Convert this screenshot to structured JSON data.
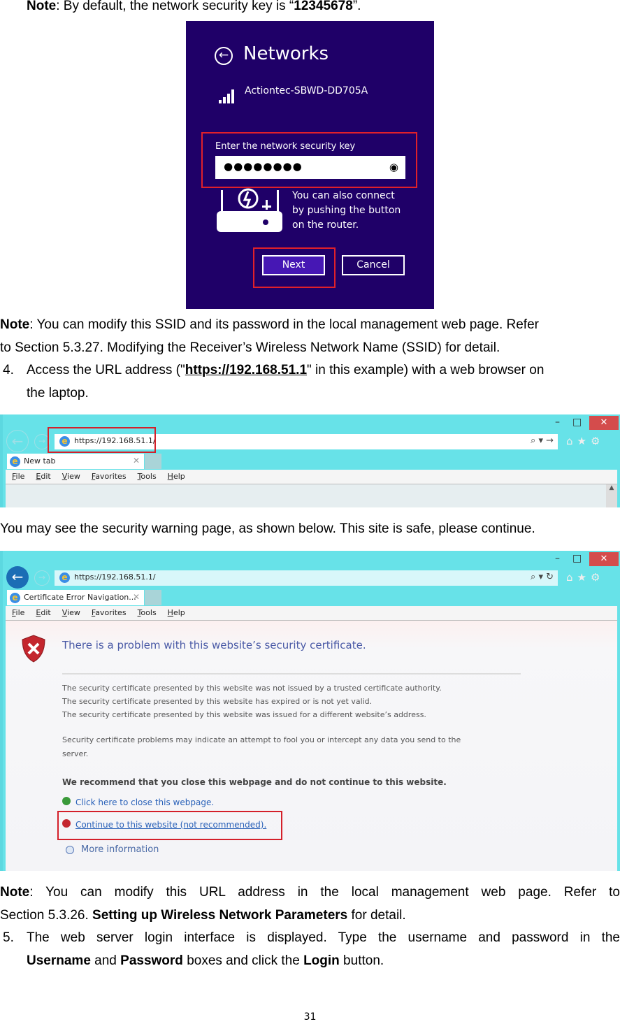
{
  "doc": {
    "note1": {
      "label": "Note",
      "text_before": ": By default, the network security key is “",
      "key": "12345678",
      "text_after": "”."
    },
    "note2": {
      "label": "Note",
      "line1_rest": ": You can modify this SSID and its password in the local management web page. Refer",
      "line2": "to Section 5.3.27. Modifying the Receiver’s Wireless Network Name (SSID) for detail."
    },
    "step4": {
      "number": "4.",
      "before": "Access the URL address (\"",
      "url": "https://192.168.51.1",
      "after": "\" in this example) with a web browser on",
      "line2": "the laptop."
    },
    "warning_text": "You may see the security warning page, as shown below. This site is safe, please continue.",
    "note3": {
      "label": "Note",
      "line1_rest": ":  You  can  modify  this  URL  address  in  the  local  management  web  page.  Refer  to",
      "line2_before": "Section 5.3.26. ",
      "line2_bold": "Setting up Wireless Network Parameters",
      "line2_after": " for detail."
    },
    "step5": {
      "number": "5.",
      "line1": "The web server login interface is displayed. Type the username and password in the",
      "b1": "Username",
      "t1": " and ",
      "b2": "Password",
      "t2": " boxes and click the ",
      "b3": "Login",
      "t3": " button."
    },
    "page_number": "31"
  },
  "networks_panel": {
    "back_icon": "←",
    "title": "Networks",
    "ssid": "Actiontec-SBWD-DD705A",
    "key_label": "Enter the network security key",
    "key_value": "●●●●●●●●",
    "wps_lines": [
      "You can also connect",
      "by pushing the button",
      "on the router."
    ],
    "next_label": "Next",
    "cancel_label": "Cancel",
    "colors": {
      "background": "#1f0068",
      "next": "#4617b4",
      "highlight": "#e0202a"
    }
  },
  "browser1": {
    "url": "https://192.168.51.1/",
    "tab_label": "New tab",
    "menu": [
      "File",
      "Edit",
      "View",
      "Favorites",
      "Tools",
      "Help"
    ],
    "addr_tools": "⌕ ▾ →",
    "window_buttons": {
      "minimize": "–",
      "maximize": "□",
      "close": "✕"
    },
    "toolbar_icons": "⌂★⚙"
  },
  "browser2": {
    "url": "https://192.168.51.1/",
    "tab_label": "Certificate Error Navigation...",
    "menu": [
      "File",
      "Edit",
      "View",
      "Favorites",
      "Tools",
      "Help"
    ],
    "addr_tools": "⌕ ▾ ↻",
    "window_buttons": {
      "minimize": "–",
      "maximize": "□",
      "close": "✕"
    },
    "toolbar_icons": "⌂★⚙",
    "cert": {
      "heading": "There is a problem with this website’s security certificate.",
      "reasons": [
        "The security certificate presented by this website was not issued by a trusted certificate authority.",
        "The security certificate presented by this website has expired or is not yet valid.",
        "The security certificate presented by this website was issued for a different website’s address."
      ],
      "explain1": "Security certificate problems may indicate an attempt to fool you or intercept any data you send to the",
      "explain2": "server.",
      "recommend": "We recommend that you close this webpage and do not continue to this website.",
      "close_link": "Click here to close this webpage.",
      "continue_link": "Continue to this website (not recommended).",
      "more_info": "More information"
    }
  }
}
